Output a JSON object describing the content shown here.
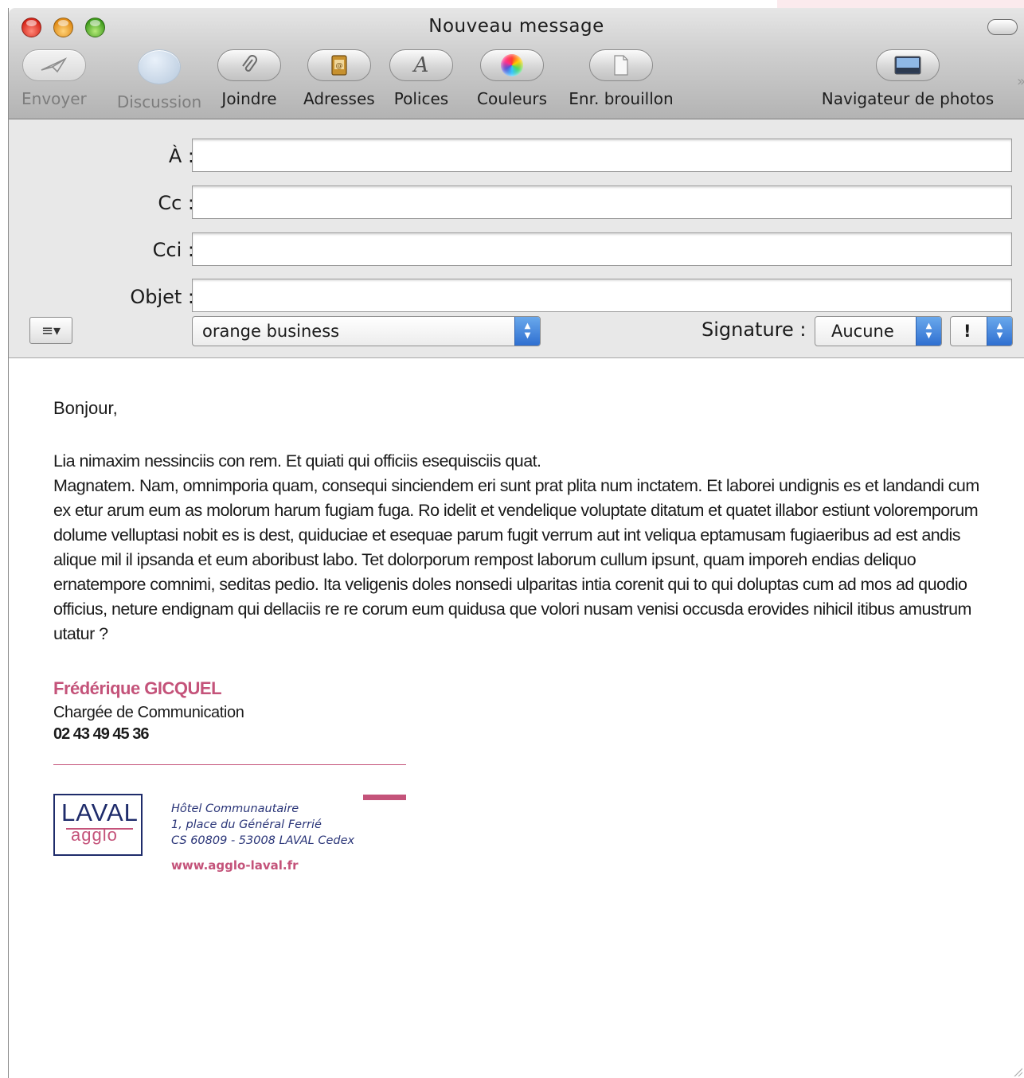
{
  "window": {
    "title": "Nouveau message"
  },
  "toolbar": {
    "items": [
      {
        "label": "Envoyer",
        "icon": "paper-plane-icon",
        "enabled": false
      },
      {
        "label": "Discussion",
        "icon": "speech-bubble-icon",
        "enabled": false
      },
      {
        "label": "Joindre",
        "icon": "paperclip-icon",
        "enabled": true
      },
      {
        "label": "Adresses",
        "icon": "address-book-icon",
        "enabled": true
      },
      {
        "label": "Polices",
        "icon": "font-a-icon",
        "enabled": true
      },
      {
        "label": "Couleurs",
        "icon": "color-wheel-icon",
        "enabled": true
      },
      {
        "label": "Enr. brouillon",
        "icon": "draft-document-icon",
        "enabled": true
      },
      {
        "label": "Navigateur de photos",
        "icon": "photo-icon",
        "enabled": true
      }
    ],
    "overflow_glyph": "»"
  },
  "fields": {
    "to": {
      "label": "À :",
      "value": ""
    },
    "cc": {
      "label": "Cc :",
      "value": ""
    },
    "bcc": {
      "label": "Cci :",
      "value": ""
    },
    "subject": {
      "label": "Objet :",
      "value": ""
    }
  },
  "format_button": {
    "glyph": "≡▾"
  },
  "account_select": {
    "value": "orange business"
  },
  "signature": {
    "label": "Signature :",
    "value": "Aucune"
  },
  "priority": {
    "value": "!"
  },
  "message": {
    "greeting": "Bonjour,",
    "paragraph_1": "Lia nimaxim nessinciis con rem. Et quiati qui officiis esequisciis quat.",
    "paragraph_2": "Magnatem. Nam, omnimporia quam, consequi sinciendem eri sunt prat plita num inctatem. Et laborei undignis es et landandi cum ex etur arum eum as molorum harum fugiam fuga. Ro idelit et vendelique voluptate ditatum et quatet illabor estiunt voloremporum dolume velluptasi nobit es is dest, quiduciae et esequae parum fugit verrum aut int veliqua eptamusam fugiaeribus ad est andis alique mil il ipsanda et eum aboribust labo. Tet dolorporum rempost laborum cullum ipsunt, quam imporeh endias deliquo ernatempore comnimi, seditas pedio. Ita veligenis doles nonsedi ulparitas intia corenit qui to qui doluptas cum ad mos ad quodio officius, neture endignam qui dellaciis re re corum eum quidusa que volori nusam venisi occusda erovides nihicil itibus amustrum utatur ?"
  },
  "email_signature": {
    "name": "Frédérique GICQUEL",
    "role": "Chargée de Communication",
    "phone": "02 43 49 45 36",
    "logo_top": "LAVAL",
    "logo_bottom": "agglo",
    "address_line_1": "Hôtel Communautaire",
    "address_line_2": "1, place du Général Ferrié",
    "address_line_3": "CS 60809 - 53008 LAVAL Cedex",
    "website": "www.agglo-laval.fr"
  },
  "colors": {
    "accent_pink": "#c4537a",
    "logo_navy": "#1f2c6b",
    "stepper_blue": "#2f6fd0"
  }
}
